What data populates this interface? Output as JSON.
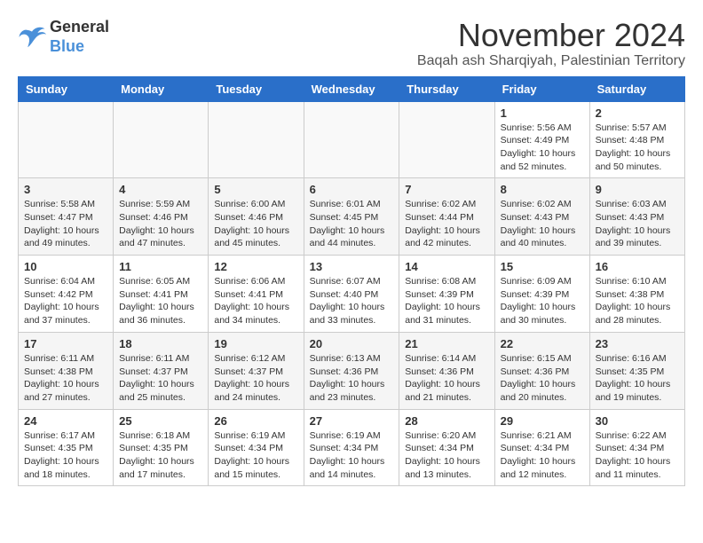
{
  "logo": {
    "line1": "General",
    "line2": "Blue"
  },
  "title": "November 2024",
  "subtitle": "Baqah ash Sharqiyah, Palestinian Territory",
  "weekdays": [
    "Sunday",
    "Monday",
    "Tuesday",
    "Wednesday",
    "Thursday",
    "Friday",
    "Saturday"
  ],
  "weeks": [
    [
      {
        "day": "",
        "info": ""
      },
      {
        "day": "",
        "info": ""
      },
      {
        "day": "",
        "info": ""
      },
      {
        "day": "",
        "info": ""
      },
      {
        "day": "",
        "info": ""
      },
      {
        "day": "1",
        "info": "Sunrise: 5:56 AM\nSunset: 4:49 PM\nDaylight: 10 hours\nand 52 minutes."
      },
      {
        "day": "2",
        "info": "Sunrise: 5:57 AM\nSunset: 4:48 PM\nDaylight: 10 hours\nand 50 minutes."
      }
    ],
    [
      {
        "day": "3",
        "info": "Sunrise: 5:58 AM\nSunset: 4:47 PM\nDaylight: 10 hours\nand 49 minutes."
      },
      {
        "day": "4",
        "info": "Sunrise: 5:59 AM\nSunset: 4:46 PM\nDaylight: 10 hours\nand 47 minutes."
      },
      {
        "day": "5",
        "info": "Sunrise: 6:00 AM\nSunset: 4:46 PM\nDaylight: 10 hours\nand 45 minutes."
      },
      {
        "day": "6",
        "info": "Sunrise: 6:01 AM\nSunset: 4:45 PM\nDaylight: 10 hours\nand 44 minutes."
      },
      {
        "day": "7",
        "info": "Sunrise: 6:02 AM\nSunset: 4:44 PM\nDaylight: 10 hours\nand 42 minutes."
      },
      {
        "day": "8",
        "info": "Sunrise: 6:02 AM\nSunset: 4:43 PM\nDaylight: 10 hours\nand 40 minutes."
      },
      {
        "day": "9",
        "info": "Sunrise: 6:03 AM\nSunset: 4:43 PM\nDaylight: 10 hours\nand 39 minutes."
      }
    ],
    [
      {
        "day": "10",
        "info": "Sunrise: 6:04 AM\nSunset: 4:42 PM\nDaylight: 10 hours\nand 37 minutes."
      },
      {
        "day": "11",
        "info": "Sunrise: 6:05 AM\nSunset: 4:41 PM\nDaylight: 10 hours\nand 36 minutes."
      },
      {
        "day": "12",
        "info": "Sunrise: 6:06 AM\nSunset: 4:41 PM\nDaylight: 10 hours\nand 34 minutes."
      },
      {
        "day": "13",
        "info": "Sunrise: 6:07 AM\nSunset: 4:40 PM\nDaylight: 10 hours\nand 33 minutes."
      },
      {
        "day": "14",
        "info": "Sunrise: 6:08 AM\nSunset: 4:39 PM\nDaylight: 10 hours\nand 31 minutes."
      },
      {
        "day": "15",
        "info": "Sunrise: 6:09 AM\nSunset: 4:39 PM\nDaylight: 10 hours\nand 30 minutes."
      },
      {
        "day": "16",
        "info": "Sunrise: 6:10 AM\nSunset: 4:38 PM\nDaylight: 10 hours\nand 28 minutes."
      }
    ],
    [
      {
        "day": "17",
        "info": "Sunrise: 6:11 AM\nSunset: 4:38 PM\nDaylight: 10 hours\nand 27 minutes."
      },
      {
        "day": "18",
        "info": "Sunrise: 6:11 AM\nSunset: 4:37 PM\nDaylight: 10 hours\nand 25 minutes."
      },
      {
        "day": "19",
        "info": "Sunrise: 6:12 AM\nSunset: 4:37 PM\nDaylight: 10 hours\nand 24 minutes."
      },
      {
        "day": "20",
        "info": "Sunrise: 6:13 AM\nSunset: 4:36 PM\nDaylight: 10 hours\nand 23 minutes."
      },
      {
        "day": "21",
        "info": "Sunrise: 6:14 AM\nSunset: 4:36 PM\nDaylight: 10 hours\nand 21 minutes."
      },
      {
        "day": "22",
        "info": "Sunrise: 6:15 AM\nSunset: 4:36 PM\nDaylight: 10 hours\nand 20 minutes."
      },
      {
        "day": "23",
        "info": "Sunrise: 6:16 AM\nSunset: 4:35 PM\nDaylight: 10 hours\nand 19 minutes."
      }
    ],
    [
      {
        "day": "24",
        "info": "Sunrise: 6:17 AM\nSunset: 4:35 PM\nDaylight: 10 hours\nand 18 minutes."
      },
      {
        "day": "25",
        "info": "Sunrise: 6:18 AM\nSunset: 4:35 PM\nDaylight: 10 hours\nand 17 minutes."
      },
      {
        "day": "26",
        "info": "Sunrise: 6:19 AM\nSunset: 4:34 PM\nDaylight: 10 hours\nand 15 minutes."
      },
      {
        "day": "27",
        "info": "Sunrise: 6:19 AM\nSunset: 4:34 PM\nDaylight: 10 hours\nand 14 minutes."
      },
      {
        "day": "28",
        "info": "Sunrise: 6:20 AM\nSunset: 4:34 PM\nDaylight: 10 hours\nand 13 minutes."
      },
      {
        "day": "29",
        "info": "Sunrise: 6:21 AM\nSunset: 4:34 PM\nDaylight: 10 hours\nand 12 minutes."
      },
      {
        "day": "30",
        "info": "Sunrise: 6:22 AM\nSunset: 4:34 PM\nDaylight: 10 hours\nand 11 minutes."
      }
    ]
  ]
}
